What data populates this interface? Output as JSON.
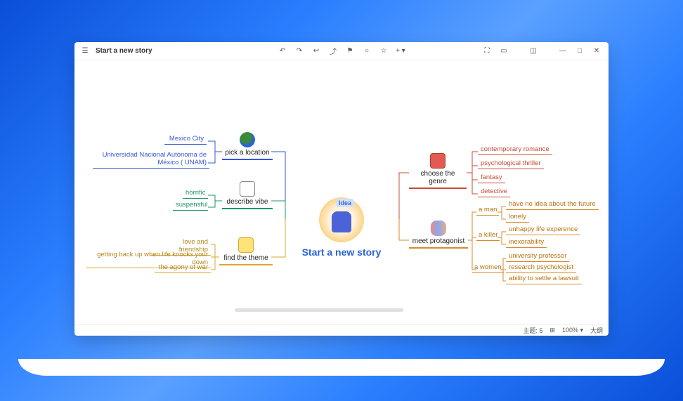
{
  "window": {
    "title": "Start a new story"
  },
  "toolbar": {
    "back": "↶",
    "forward": "↷",
    "undo": "↩",
    "redo": "⤴",
    "flag": "⚑",
    "circle": "○",
    "star": "☆",
    "plus": "+ ▾",
    "fullscreen": "⛶",
    "present": "▭",
    "panel": "◫",
    "minimize": "—",
    "maximize": "□",
    "close": "✕"
  },
  "central": {
    "title": "Start a new story",
    "badge": "Idea"
  },
  "topics": {
    "location": {
      "label": "pick a location",
      "color": "#3557d6"
    },
    "vibe": {
      "label": "describe vibe",
      "color": "#1e946f"
    },
    "theme": {
      "label": "find the theme",
      "color": "#d6aa2f"
    },
    "genre": {
      "label": "choose the genre",
      "color": "#c84a33"
    },
    "protagonist": {
      "label": "meet protagonist",
      "color": "#d98a2b"
    }
  },
  "leaves": {
    "location": [
      "Mexico City",
      "Universidad Nacional Autónoma de México ( UNAM)"
    ],
    "vibe": [
      "horrific",
      "suspensful"
    ],
    "theme": [
      "love and friendship",
      "getting back up when life knocks your down",
      "the agony of war"
    ],
    "genre": [
      "contemporary romance",
      "psychological thriller",
      "fantasy",
      "detective"
    ],
    "protagonist": {
      "groups": [
        {
          "label": "a  man",
          "children": [
            "have no idea about the future",
            "lonely"
          ]
        },
        {
          "label": "a  killer",
          "children": [
            "unhappy life experence",
            "inexorability"
          ]
        },
        {
          "label": "a women",
          "children": [
            "university professor",
            "research psychologist",
            "ability to settle a lawsuit"
          ]
        }
      ]
    }
  },
  "status": {
    "topic_label": "主题: 5",
    "map_icon": "⊞",
    "zoom": "100% ▾",
    "outline": "大纲"
  }
}
